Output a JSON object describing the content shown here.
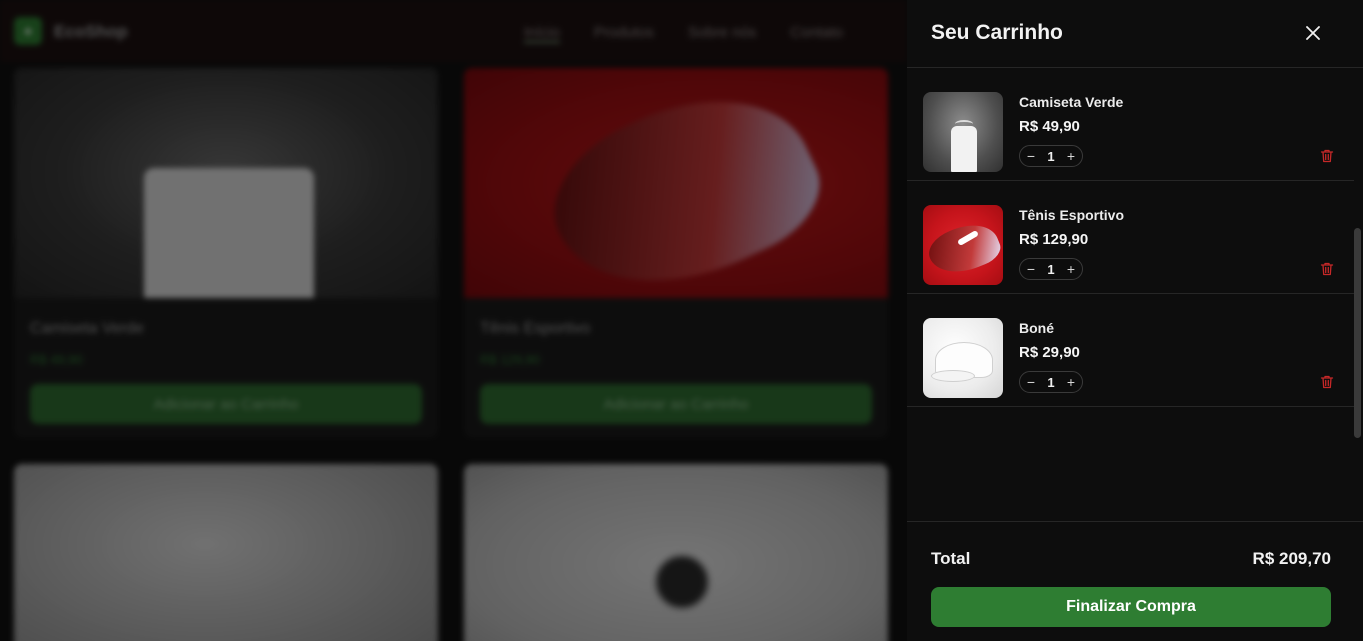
{
  "background": {
    "brand": "EcoShop",
    "nav": [
      "Início",
      "Produtos",
      "Sobre nós",
      "Contato"
    ],
    "products": [
      {
        "name": "Camiseta Verde",
        "price": "R$ 49,90",
        "button": "Adicionar ao Carrinho"
      },
      {
        "name": "Tênis Esportivo",
        "price": "R$ 129,90",
        "button": "Adicionar ao Carrinho"
      }
    ]
  },
  "cart": {
    "title": "Seu Carrinho",
    "close_icon": "close-icon",
    "items": [
      {
        "name": "Camiseta Verde",
        "price": "R$ 49,90",
        "quantity": "1",
        "image": "white-tshirt-on-hanger"
      },
      {
        "name": "Tênis Esportivo",
        "price": "R$ 129,90",
        "quantity": "1",
        "image": "red-sneaker"
      },
      {
        "name": "Boné",
        "price": "R$ 29,90",
        "quantity": "1",
        "image": "white-cap"
      }
    ],
    "total_label": "Total",
    "total_value": "R$ 209,70",
    "checkout_label": "Finalizar Compra"
  },
  "colors": {
    "accent": "#2e7d32",
    "danger": "#d32f2f",
    "drawer_bg": "#0d0d0d"
  }
}
